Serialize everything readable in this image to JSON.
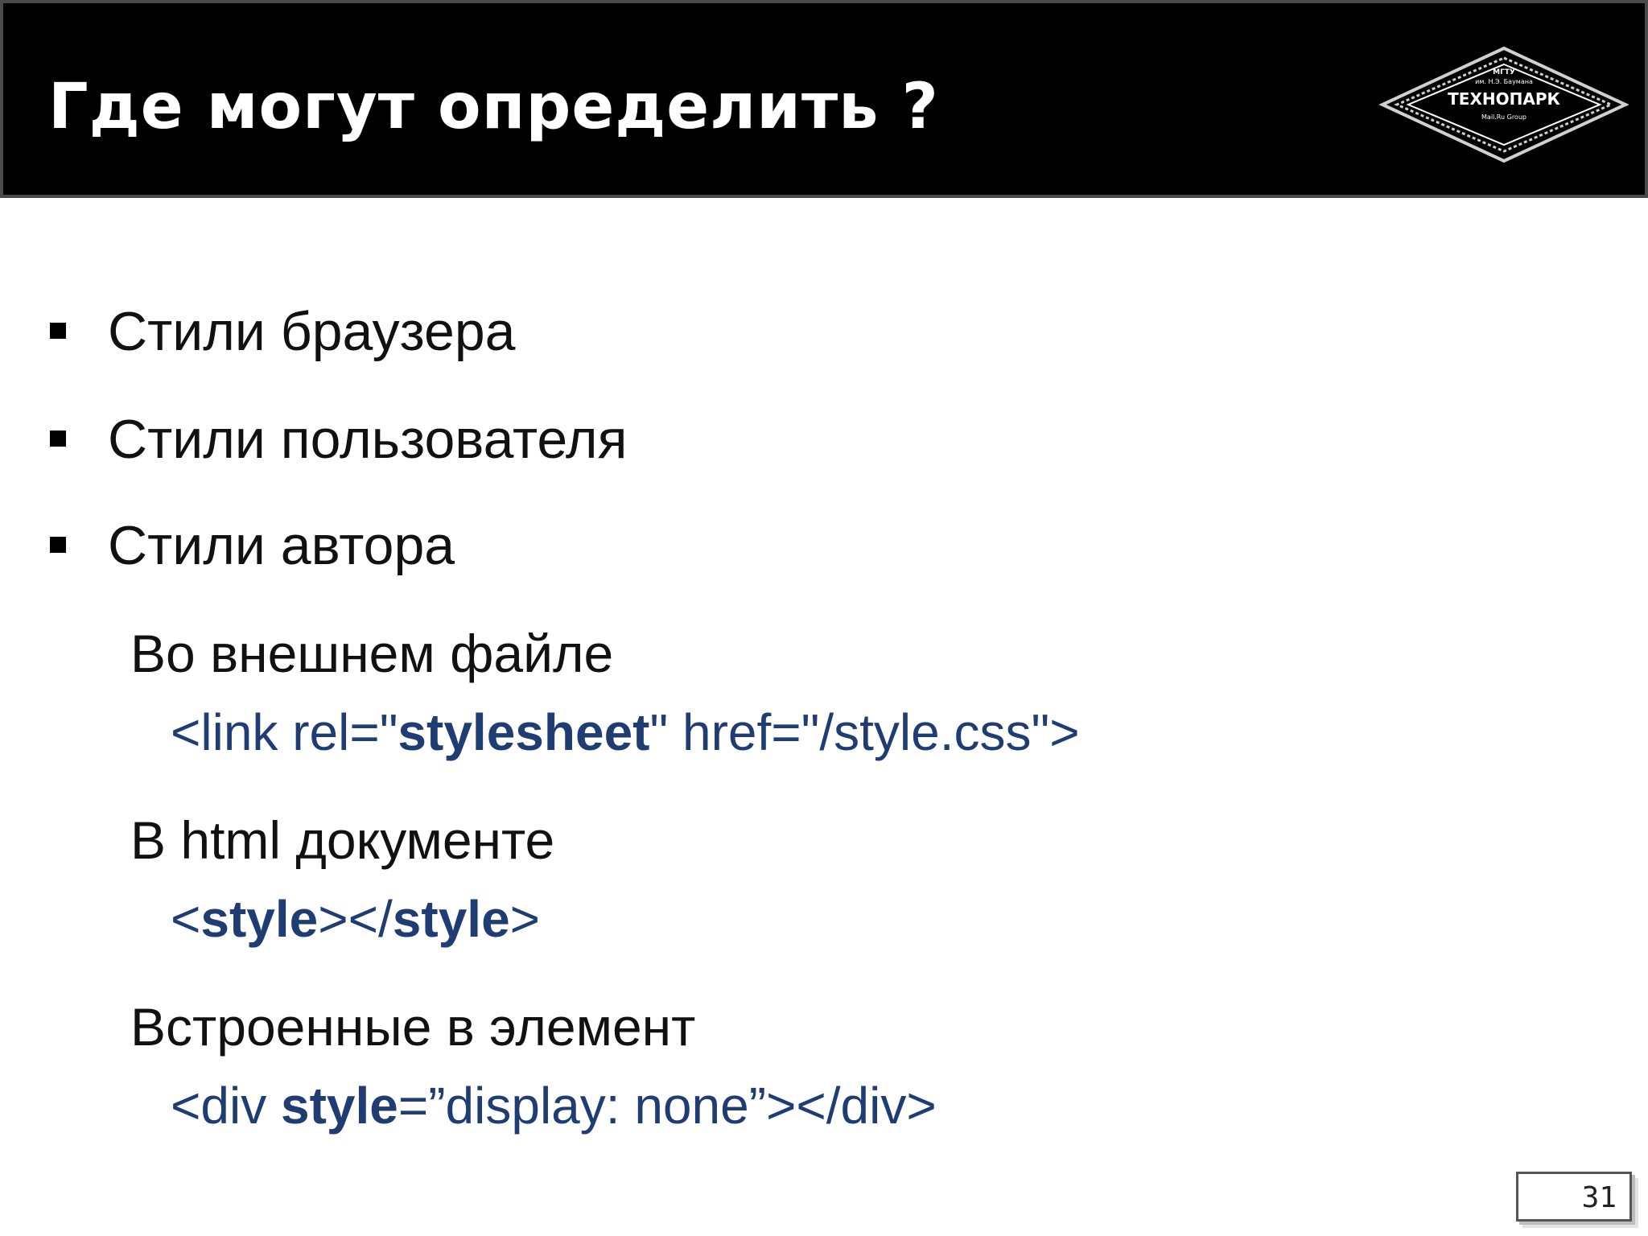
{
  "header": {
    "title": "Где могут определить ?",
    "logo": {
      "icon": "technopark-logo-icon",
      "line1": "МГТУ",
      "line2": "им. Н.Э. Баумана",
      "name": "ТЕХНОПАРК",
      "line3": "Mail.Ru Group"
    }
  },
  "bullets": [
    "Стили браузера",
    "Стили пользователя",
    "Стили автора"
  ],
  "author_styles": {
    "external": {
      "heading": "Во внешнем файле",
      "code": {
        "p1": "<link rel=\"",
        "kw": "stylesheet",
        "p2": "\" href=\"/style.css\">"
      }
    },
    "document": {
      "heading": "В html документе",
      "code": {
        "p1": "<",
        "kw1": "style",
        "p2": "></",
        "kw2": "style",
        "p3": ">"
      }
    },
    "inline": {
      "heading": "Встроенные в элемент",
      "code": {
        "p1": "<div ",
        "kw": "style",
        "p2": "=”display: none”></div>"
      }
    }
  },
  "page_number": "31",
  "colors": {
    "header_bg": "#000000",
    "title": "#ffffff",
    "code": "#1f3d73"
  }
}
